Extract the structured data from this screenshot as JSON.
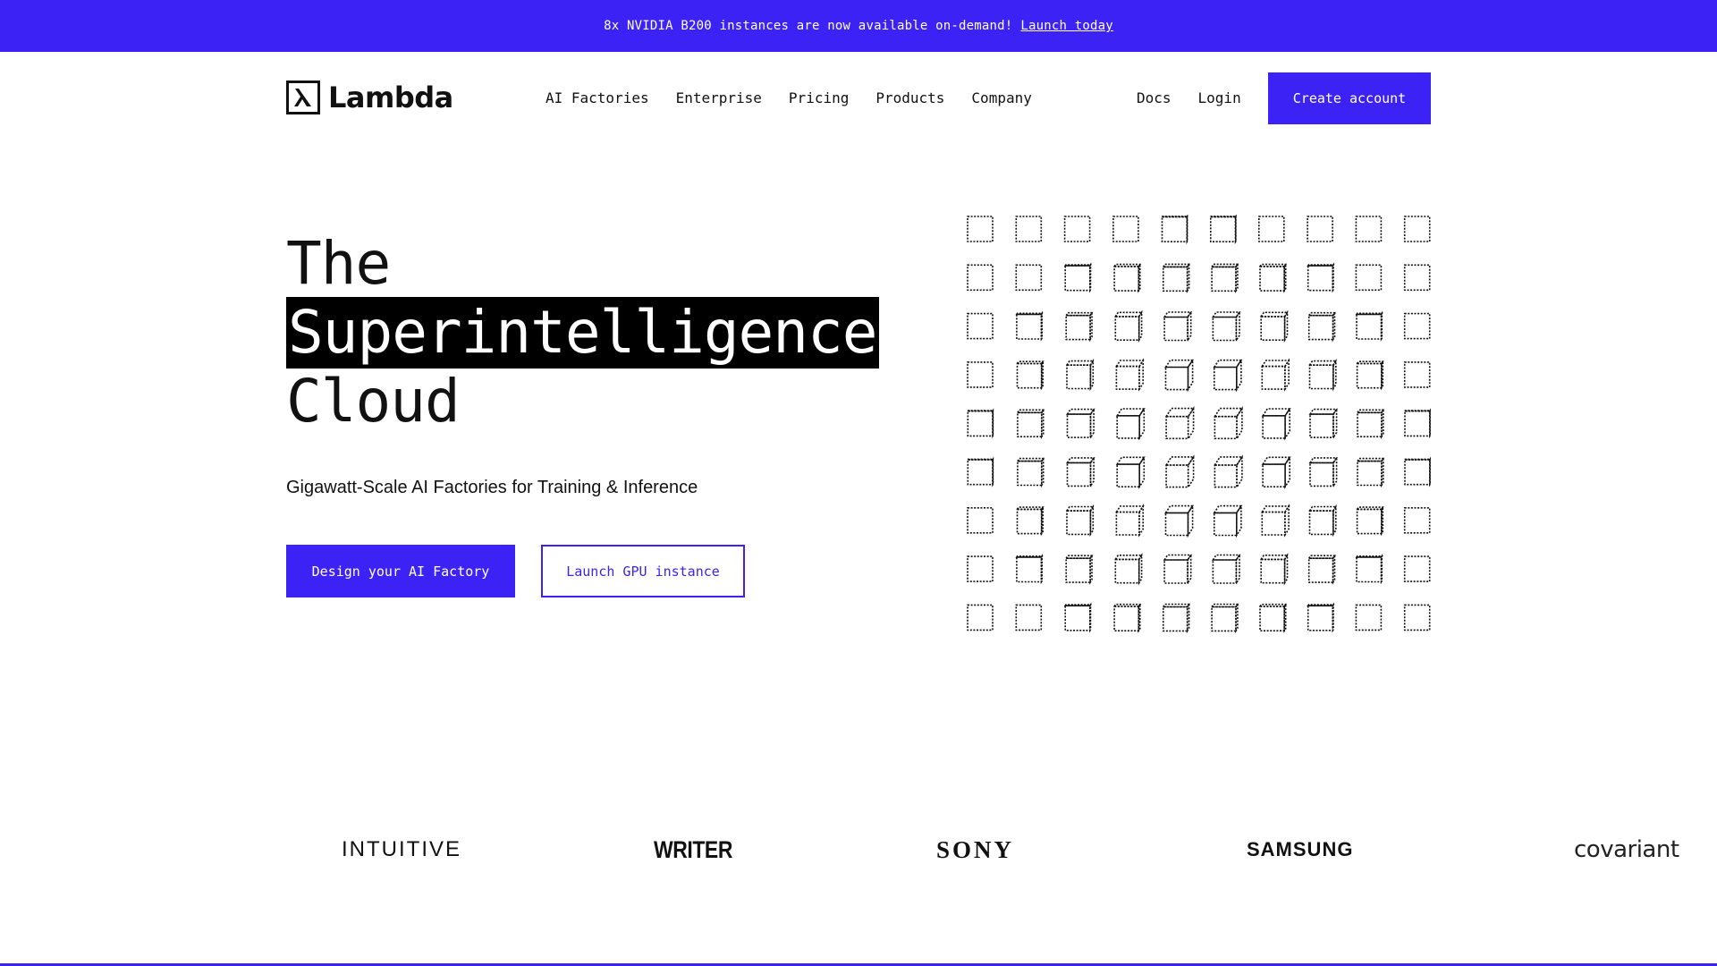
{
  "banner": {
    "text": "8x NVIDIA B200 instances are now available on-demand!",
    "link": "Launch today"
  },
  "header": {
    "logo_text": "Lambda",
    "nav": [
      "AI Factories",
      "Enterprise",
      "Pricing",
      "Products",
      "Company"
    ],
    "docs": "Docs",
    "login": "Login",
    "cta": "Create account"
  },
  "hero": {
    "title_line1": "The",
    "title_highlight": "Superintelligence",
    "title_line3": "Cloud",
    "subtitle": "Gigawatt-Scale AI Factories for Training & Inference",
    "primary_button": "Design your AI Factory",
    "secondary_button": "Launch GPU instance"
  },
  "logos": [
    "INTUITIVE",
    "WRITER",
    "SONY",
    "SAMSUNG",
    "covariant"
  ],
  "colors": {
    "accent": "#3d22f5",
    "text": "#111111",
    "background": "#ffffff"
  }
}
